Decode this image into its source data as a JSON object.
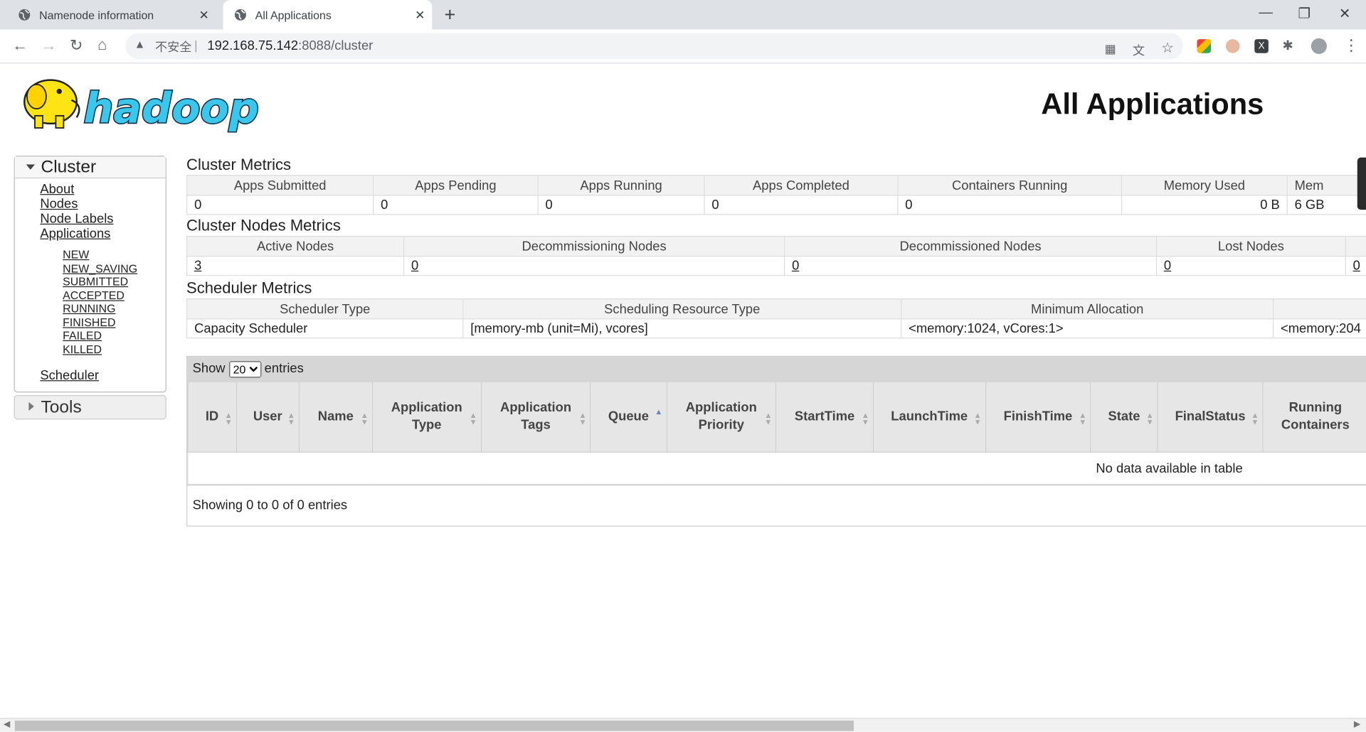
{
  "browser": {
    "tabs": [
      {
        "title": "Namenode information"
      },
      {
        "title": "All Applications"
      }
    ],
    "address": {
      "insecure_label": "不安全",
      "separator": "|",
      "host": "192.168.75.142",
      "path": ":8088/cluster"
    }
  },
  "header": {
    "logo_text": "hadoop",
    "title": "All Applications"
  },
  "sidebar": {
    "cluster_label": "Cluster",
    "links": [
      "About",
      "Nodes",
      "Node Labels",
      "Applications"
    ],
    "app_states": [
      "NEW",
      "NEW_SAVING",
      "SUBMITTED",
      "ACCEPTED",
      "RUNNING",
      "FINISHED",
      "FAILED",
      "KILLED"
    ],
    "scheduler_label": "Scheduler",
    "tools_label": "Tools"
  },
  "cluster_metrics": {
    "title": "Cluster Metrics",
    "headers": [
      "Apps Submitted",
      "Apps Pending",
      "Apps Running",
      "Apps Completed",
      "Containers Running",
      "Memory Used",
      "Mem"
    ],
    "values": [
      "0",
      "0",
      "0",
      "0",
      "0",
      "0 B",
      "6 GB"
    ]
  },
  "node_metrics": {
    "title": "Cluster Nodes Metrics",
    "headers": [
      "Active Nodes",
      "Decommissioning Nodes",
      "Decommissioned Nodes",
      "Lost Nodes",
      ""
    ],
    "values": [
      "3",
      "0",
      "0",
      "0",
      "0"
    ]
  },
  "scheduler_metrics": {
    "title": "Scheduler Metrics",
    "headers": [
      "Scheduler Type",
      "Scheduling Resource Type",
      "Minimum Allocation",
      ""
    ],
    "values": [
      "Capacity Scheduler",
      "[memory-mb (unit=Mi), vcores]",
      "<memory:1024, vCores:1>",
      "<memory:204"
    ]
  },
  "apps_table": {
    "show_label": "Show",
    "page_size": "20",
    "entries_label": "entries",
    "columns": [
      "ID",
      "User",
      "Name",
      "Application Type",
      "Application Tags",
      "Queue",
      "Application Priority",
      "StartTime",
      "LaunchTime",
      "FinishTime",
      "State",
      "FinalStatus",
      "Running Containers"
    ],
    "empty_message": "No data available in table",
    "summary": "Showing 0 to 0 of 0 entries"
  }
}
